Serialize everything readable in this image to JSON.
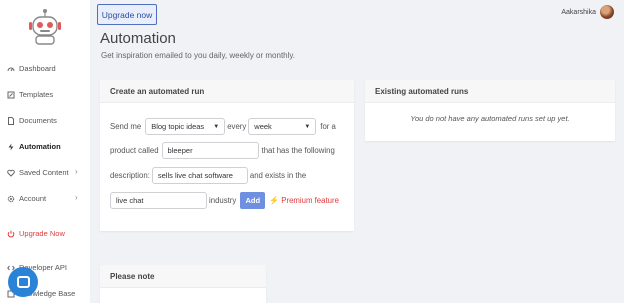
{
  "sidebar": {
    "items": [
      {
        "label": "Dashboard"
      },
      {
        "label": "Templates"
      },
      {
        "label": "Documents"
      },
      {
        "label": "Automation"
      },
      {
        "label": "Saved Content"
      },
      {
        "label": "Account"
      },
      {
        "label": "Upgrade Now"
      },
      {
        "label": "Developer API"
      },
      {
        "label": "Knowledge Base"
      }
    ]
  },
  "header": {
    "upgrade_label": "Upgrade now",
    "user_name": "Aakarshika"
  },
  "page": {
    "title": "Automation",
    "subtitle": "Get inspiration emailed to you daily, weekly or monthly."
  },
  "create": {
    "title": "Create an automated run",
    "send_me": "Send me",
    "content_type": "Blog topic ideas",
    "every": "every",
    "frequency": "week",
    "for_a": "for a",
    "product_called": "product called",
    "product_name": "bleeper",
    "following": "that has the following",
    "description_label": "description:",
    "description": "sells live chat software",
    "exists_in": "and exists in the",
    "industry_value": "live chat",
    "industry": "industry",
    "add_label": "Add",
    "premium_label": "Premium feature"
  },
  "existing": {
    "title": "Existing automated runs",
    "empty": "You do not have any automated runs set up yet."
  },
  "note": {
    "title": "Please note"
  },
  "colors": {
    "accent": "#6f8fe0",
    "danger": "#e03b3b",
    "chat": "#2a83d6"
  }
}
